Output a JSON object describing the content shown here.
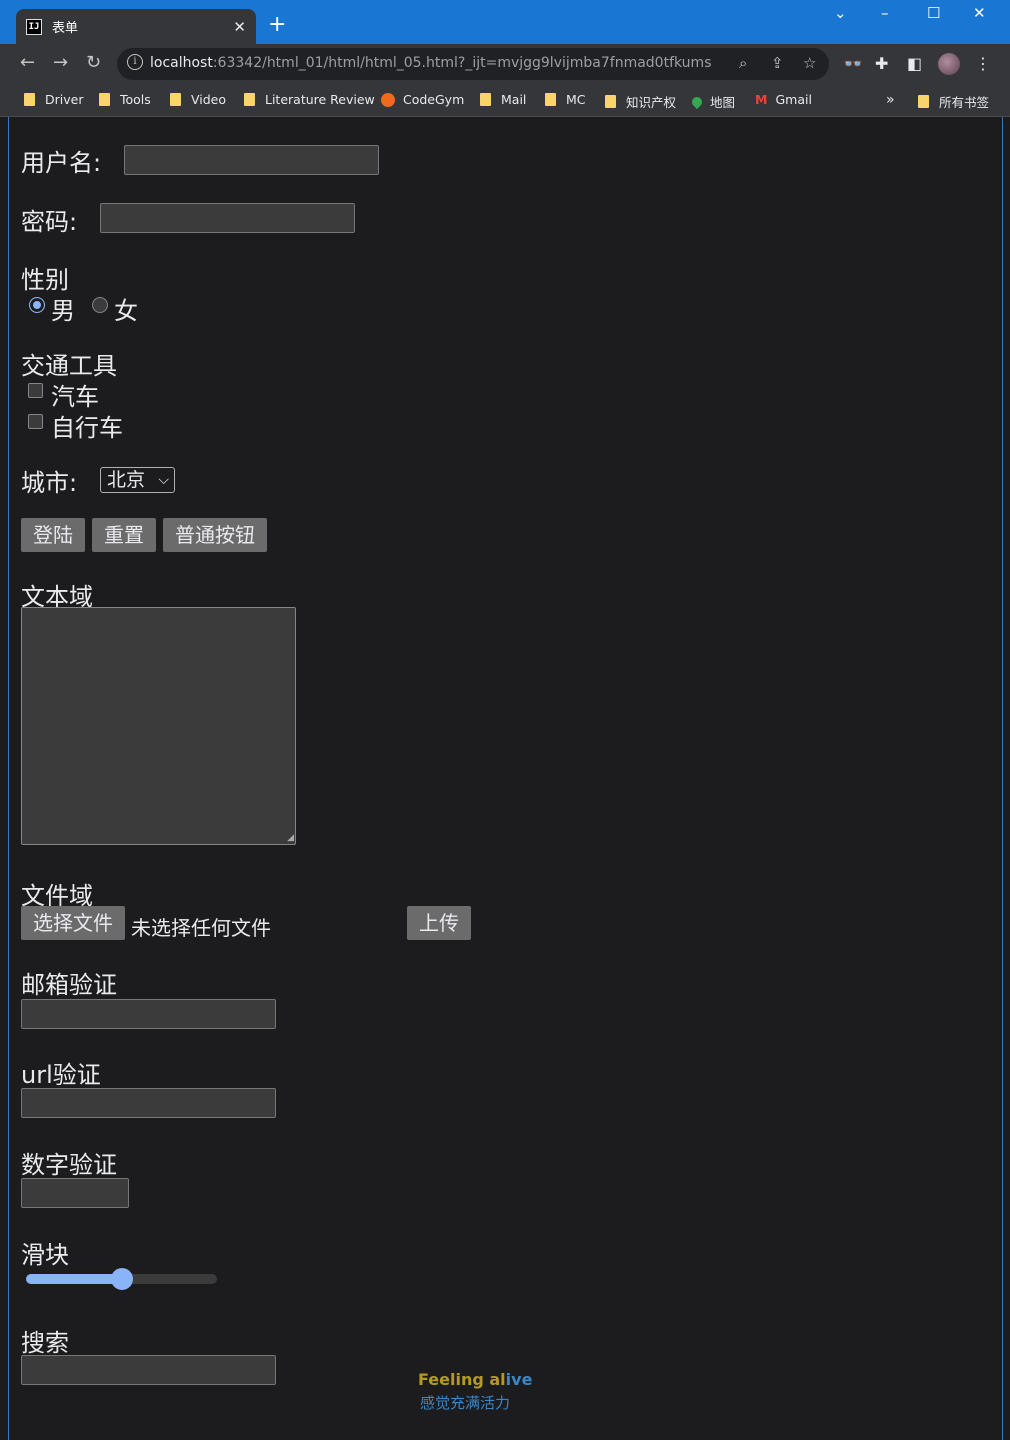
{
  "browser": {
    "tab_title": "表单",
    "tab_favicon_text": "IJ",
    "url_host": "localhost",
    "url_rest": ":63342/html_01/html/html_05.html?_ijt=mvjgg9lvijmba7fnmad0tfkums",
    "bookmarks": [
      "Driver",
      "Tools",
      "Video",
      "Literature Review",
      "CodeGym",
      "Mail",
      "MC",
      "知识产权",
      "地图",
      "Gmail"
    ],
    "all_bookmarks": "所有书签"
  },
  "form": {
    "username_label": "用户名:",
    "password_label": "密码:",
    "gender_label": "性别",
    "gender_options": [
      "男",
      "女"
    ],
    "gender_selected": "男",
    "vehicle_label": "交通工具",
    "vehicle_options": [
      "汽车",
      "自行车"
    ],
    "city_label": "城市:",
    "city_selected": "北京",
    "buttons": {
      "login": "登陆",
      "reset": "重置",
      "normal": "普通按钮"
    },
    "textarea_label": "文本域",
    "file_label": "文件域",
    "file_choose": "选择文件",
    "file_none": "未选择任何文件",
    "upload": "上传",
    "email_label": "邮箱验证",
    "url_label": "url验证",
    "number_label": "数字验证",
    "slider_label": "滑块",
    "slider_value": 0.5,
    "search_label": "搜索"
  },
  "watermark": {
    "line1_a": "Feeling al",
    "line1_b": "ive",
    "line2": "感觉充满活力"
  },
  "colors": {
    "accent": "#8ab4f8",
    "titlebar": "#1976d2",
    "page_bg": "#1c1c1e"
  }
}
